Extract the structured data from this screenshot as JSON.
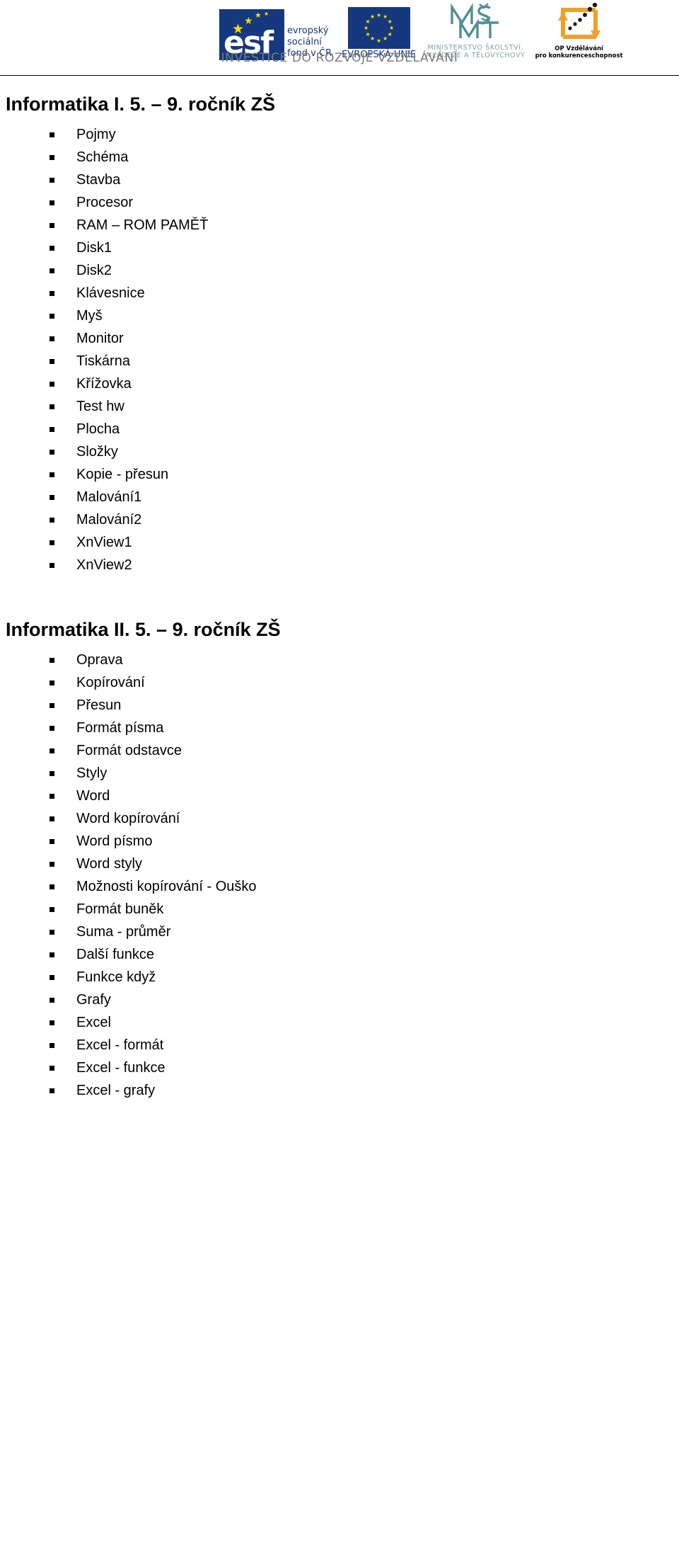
{
  "header": {
    "logos": {
      "esf": {
        "name": "esf-logo",
        "letters": "esf",
        "line1": "evropský",
        "line2": "sociální",
        "line3": "fond v ČR"
      },
      "eu": {
        "name": "european-union-flag-logo",
        "caption": "EVROPSKÁ UNIE"
      },
      "msmt": {
        "name": "msmt-logo",
        "mark": "MŠMT",
        "caption_line1": "MINISTERSTVO ŠKOLSTVÍ,",
        "caption_line2": "MLÁDEŽE A TĚLOVÝCHOVY"
      },
      "op": {
        "name": "op-vzdelavani-logo",
        "caption_line1": "OP Vzdělávání",
        "caption_line2": "pro konkurenceschopnost"
      }
    },
    "tagline": "INVESTICE DO ROZVOJE VZDĚLÁVÁNÍ"
  },
  "sections": [
    {
      "title": "Informatika I. 5. – 9. ročník ZŠ",
      "items": [
        "Pojmy",
        "Schéma",
        "Stavba",
        "Procesor",
        "RAM – ROM PAMĚŤ",
        "Disk1",
        "Disk2",
        "Klávesnice",
        "Myš",
        "Monitor",
        "Tiskárna",
        "Křížovka",
        "Test hw",
        "Plocha",
        "Složky",
        "Kopie - přesun",
        "Malování1",
        "Malování2",
        "XnView1",
        "XnView2"
      ]
    },
    {
      "title": "Informatika II. 5. – 9. ročník ZŠ",
      "items": [
        "Oprava",
        "Kopírování",
        "Přesun",
        "Formát písma",
        "Formát odstavce",
        "Styly",
        "Word",
        "Word kopírování",
        "Word písmo",
        "Word styly",
        "Možnosti kopírování - Ouško",
        "Formát buněk",
        "Suma - průměr",
        "Další funkce",
        "Funkce když",
        "Grafy",
        "Excel",
        "Excel - formát",
        "Excel - funkce",
        "Excel - grafy"
      ]
    }
  ],
  "colors": {
    "eu_blue": "#16387f",
    "eu_yellow": "#ffdd00",
    "msmt_teal": "#7fa3a8",
    "op_orange": "#f0a028",
    "tagline_gray": "#7a7a7a"
  }
}
